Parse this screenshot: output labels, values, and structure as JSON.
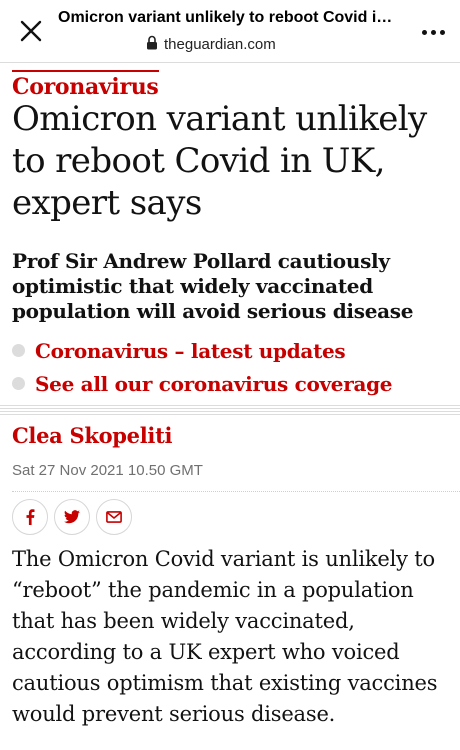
{
  "browser": {
    "title": "Omicron variant unlikely to reboot Covid in U...",
    "url": "theguardian.com",
    "close_icon": "close-icon",
    "more_icon": "more-icon",
    "lock_icon": "lock-icon"
  },
  "article": {
    "kicker": "Coronavirus",
    "headline": "Omicron variant unlikely to reboot Covid in UK, expert says",
    "standfirst": "Prof Sir Andrew Pollard cautiously optimistic that widely vaccinated population will avoid serious disease",
    "related_links": [
      {
        "label": "Coronavirus – latest updates"
      },
      {
        "label": "See all our coronavirus coverage"
      }
    ],
    "byline": "Clea Skopeliti",
    "dateline": "Sat 27 Nov 2021 10.50 GMT",
    "share_icons": [
      "facebook-icon",
      "twitter-icon",
      "email-icon"
    ],
    "body": "The Omicron Covid variant is unlikely to “reboot” the pandemic in a population that has been widely vaccinated, according to a UK expert who voiced cautious optimism that existing vaccines would prevent serious disease."
  },
  "colors": {
    "accent": "#c70000",
    "text": "#121212",
    "muted": "#707070"
  }
}
